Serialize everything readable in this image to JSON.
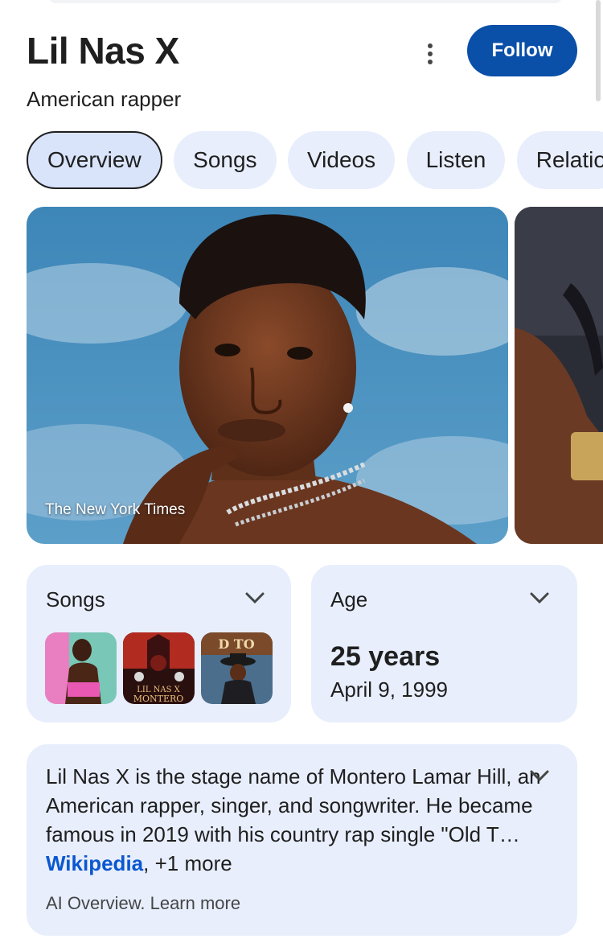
{
  "header": {
    "title": "Lil Nas X",
    "subtitle": "American rapper",
    "follow_label": "Follow"
  },
  "tabs": [
    {
      "label": "Overview",
      "active": true
    },
    {
      "label": "Songs",
      "active": false
    },
    {
      "label": "Videos",
      "active": false
    },
    {
      "label": "Listen",
      "active": false
    },
    {
      "label": "Relatio",
      "active": false
    }
  ],
  "hero": {
    "caption": "The New York Times"
  },
  "songs_card": {
    "label": "Songs",
    "thumbnail_texts": [
      "LIL NAS X",
      "MONTERO",
      "D TO"
    ]
  },
  "age_card": {
    "label": "Age",
    "value": "25 years",
    "date": "April 9, 1999"
  },
  "ai_overview": {
    "text": "Lil Nas X is the stage name of Montero Lamar Hill, an American rapper, singer, and songwriter. He became famous in 2019 with his country rap single \"Old T",
    "ellipsis": "… ",
    "source_link": "Wikipedia",
    "more": ", +1 more",
    "footer": "AI Overview. Learn more"
  },
  "colors": {
    "accent": "#0a4fa8",
    "chip_bg": "#e8eefc",
    "link": "#0b57d0"
  },
  "icons": [
    "more-vert-icon",
    "chevron-down-icon"
  ]
}
